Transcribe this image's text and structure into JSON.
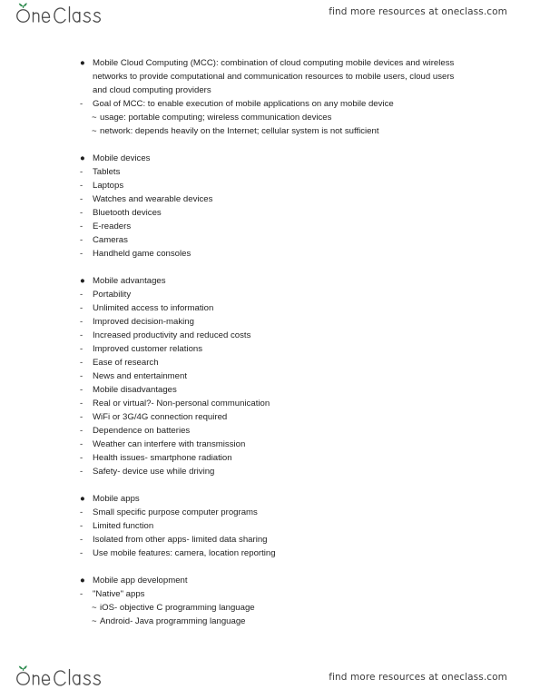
{
  "brand": {
    "name": "OneClass",
    "logo_icon": "oneclass-sprout-logo",
    "leaf_color": "#2e8b4f",
    "wordmark_color": "#4a4a4a"
  },
  "header": {
    "promo": "find more resources at oneclass.com"
  },
  "footer": {
    "promo": "find more resources at oneclass.com"
  },
  "document": {
    "blocks": [
      {
        "id": "mobile-cloud-computing",
        "lines": [
          {
            "level": "bullet",
            "marker": "●",
            "text": "Mobile Cloud Computing (MCC): combination of cloud computing mobile devices and wireless networks to provide computational and communication resources to mobile users, cloud users and cloud computing providers"
          },
          {
            "level": "dash",
            "marker": "-",
            "text": "Goal of MCC: to enable execution of mobile applications on any mobile device"
          },
          {
            "level": "tilde",
            "marker": "~",
            "text": "usage: portable computing; wireless communication devices"
          },
          {
            "level": "tilde",
            "marker": "~",
            "text": "network: depends heavily on the Internet; cellular system is not sufficient"
          }
        ]
      },
      {
        "id": "mobile-devices",
        "lines": [
          {
            "level": "bullet",
            "marker": "●",
            "text": "Mobile devices"
          },
          {
            "level": "dash",
            "marker": "-",
            "text": "Tablets"
          },
          {
            "level": "dash",
            "marker": "-",
            "text": "Laptops"
          },
          {
            "level": "dash",
            "marker": "-",
            "text": "Watches and wearable devices"
          },
          {
            "level": "dash",
            "marker": "-",
            "text": "Bluetooth devices"
          },
          {
            "level": "dash",
            "marker": "-",
            "text": "E-readers"
          },
          {
            "level": "dash",
            "marker": "-",
            "text": "Cameras"
          },
          {
            "level": "dash",
            "marker": "-",
            "text": "Handheld game consoles"
          }
        ]
      },
      {
        "id": "mobile-advantages-and-disadvantages",
        "lines": [
          {
            "level": "bullet",
            "marker": "●",
            "text": "Mobile advantages"
          },
          {
            "level": "dash",
            "marker": "-",
            "text": "Portability"
          },
          {
            "level": "dash",
            "marker": "-",
            "text": "Unlimited access to information"
          },
          {
            "level": "dash",
            "marker": "-",
            "text": "Improved decision-making"
          },
          {
            "level": "dash",
            "marker": "-",
            "text": "Increased productivity and reduced costs"
          },
          {
            "level": "dash",
            "marker": "-",
            "text": "Improved customer relations"
          },
          {
            "level": "dash",
            "marker": "-",
            "text": "Ease of research"
          },
          {
            "level": "dash",
            "marker": "-",
            "text": "News and entertainment"
          },
          {
            "level": "dash",
            "marker": "-",
            "text": "Mobile disadvantages"
          },
          {
            "level": "dash",
            "marker": "-",
            "text": "Real or virtual?- Non-personal communication"
          },
          {
            "level": "dash",
            "marker": "-",
            "text": "WiFi or 3G/4G connection required"
          },
          {
            "level": "dash",
            "marker": "-",
            "text": "Dependence on batteries"
          },
          {
            "level": "dash",
            "marker": "-",
            "text": "Weather can interfere with transmission"
          },
          {
            "level": "dash",
            "marker": "-",
            "text": "Health issues- smartphone radiation"
          },
          {
            "level": "dash",
            "marker": "-",
            "text": "Safety- device use while driving"
          }
        ]
      },
      {
        "id": "mobile-apps",
        "lines": [
          {
            "level": "bullet",
            "marker": "●",
            "text": "Mobile apps"
          },
          {
            "level": "dash",
            "marker": "-",
            "text": "Small specific purpose computer programs"
          },
          {
            "level": "dash",
            "marker": "-",
            "text": "Limited function"
          },
          {
            "level": "dash",
            "marker": "-",
            "text": "Isolated from other apps- limited data sharing"
          },
          {
            "level": "dash",
            "marker": "-",
            "text": "Use mobile features: camera, location reporting"
          }
        ]
      },
      {
        "id": "mobile-app-development",
        "lines": [
          {
            "level": "bullet",
            "marker": "●",
            "text": "Mobile app development"
          },
          {
            "level": "dash",
            "marker": "-",
            "text": "\"Native\" apps"
          },
          {
            "level": "tilde",
            "marker": "~",
            "text": "iOS- objective C programming language"
          },
          {
            "level": "tilde",
            "marker": "~",
            "text": "Android- Java programming language"
          }
        ]
      }
    ]
  }
}
